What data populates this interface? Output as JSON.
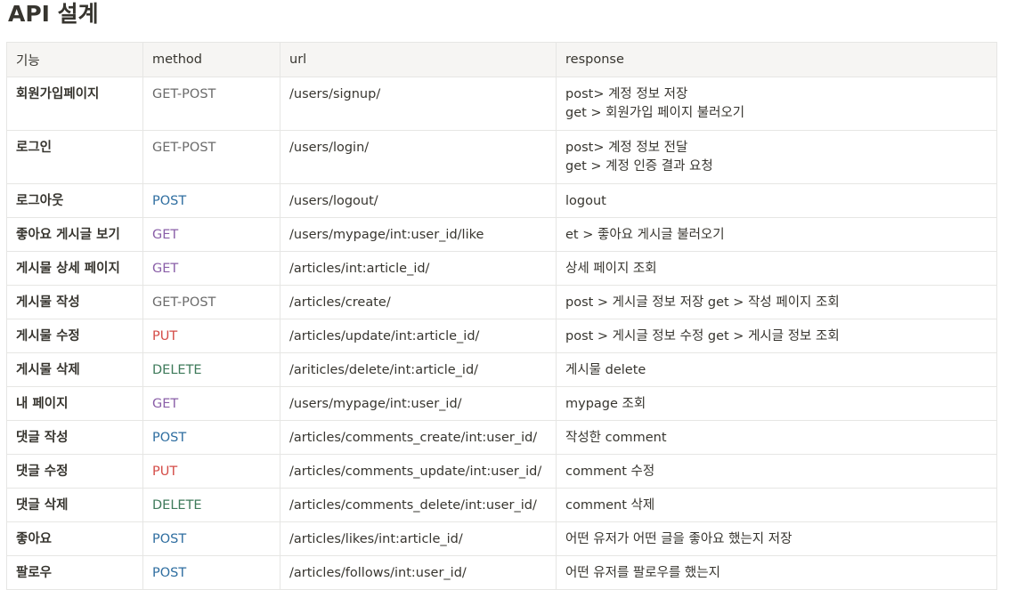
{
  "page": {
    "title": "API 설계"
  },
  "table": {
    "headers": [
      "기능",
      "method",
      "url",
      "response"
    ],
    "rows": [
      {
        "feature": "회원가입페이지",
        "method": "GET-POST",
        "url": "/users/signup/",
        "response": [
          "post> 계정 정보 저장",
          "get > 회원가입 페이지 불러오기"
        ]
      },
      {
        "feature": "로그인",
        "method": "GET-POST",
        "url": "/users/login/",
        "response": [
          "post> 계정 정보 전달",
          "get > 계정 인증 결과 요청"
        ]
      },
      {
        "feature": "로그아웃",
        "method": "POST",
        "url": "/users/logout/",
        "response": [
          "logout"
        ]
      },
      {
        "feature": "좋아요 게시글 보기",
        "method": "GET",
        "url": "/users/mypage/int:user_id/like",
        "response": [
          " et > 좋아요 게시글 불러오기"
        ]
      },
      {
        "feature": "게시물 상세 페이지",
        "method": "GET",
        "url": "/articles/int:article_id/",
        "response": [
          "상세 페이지 조회"
        ]
      },
      {
        "feature": "게시물 작성",
        "method": "GET-POST",
        "url": "/articles/create/",
        "response": [
          "post > 게시글 정보 저장 get > 작성 페이지 조회"
        ]
      },
      {
        "feature": "게시물 수정",
        "method": "PUT",
        "url": "/articles/update/int:article_id/",
        "response": [
          "post > 게시글 정보 수정 get > 게시글 정보 조회"
        ]
      },
      {
        "feature": "게시물 삭제",
        "method": "DELETE",
        "url": "/ariticles/delete/int:article_id/",
        "response": [
          "게시물 delete"
        ]
      },
      {
        "feature": "내 페이지",
        "method": "GET",
        "url": "/users/mypage/int:user_id/",
        "response": [
          "mypage 조회"
        ]
      },
      {
        "feature": "댓글 작성",
        "method": "POST",
        "url": "/articles/comments_create/int:user_id/",
        "response": [
          "작성한 comment"
        ]
      },
      {
        "feature": "댓글 수정",
        "method": "PUT",
        "url": "/articles/comments_update/int:user_id/",
        "response": [
          "comment 수정"
        ]
      },
      {
        "feature": "댓글 삭제",
        "method": "DELETE",
        "url": "/articles/comments_delete/int:user_id/",
        "response": [
          "comment 삭제"
        ]
      },
      {
        "feature": "좋아요",
        "method": "POST",
        "url": "/articles/likes/int:article_id/",
        "response": [
          "어떤 유저가 어떤 글을 좋아요 했는지 저장"
        ]
      },
      {
        "feature": "팔로우",
        "method": "POST",
        "url": "/articles/follows/int:user_id/",
        "response": [
          "어떤 유저를 팔로우를 했는지"
        ]
      }
    ]
  },
  "method_colors": {
    "GET-POST": "#6b6b6b",
    "GET": "#8a5fa8",
    "POST": "#2f6ea0",
    "PUT": "#d44c47",
    "DELETE": "#3e7a5a"
  }
}
